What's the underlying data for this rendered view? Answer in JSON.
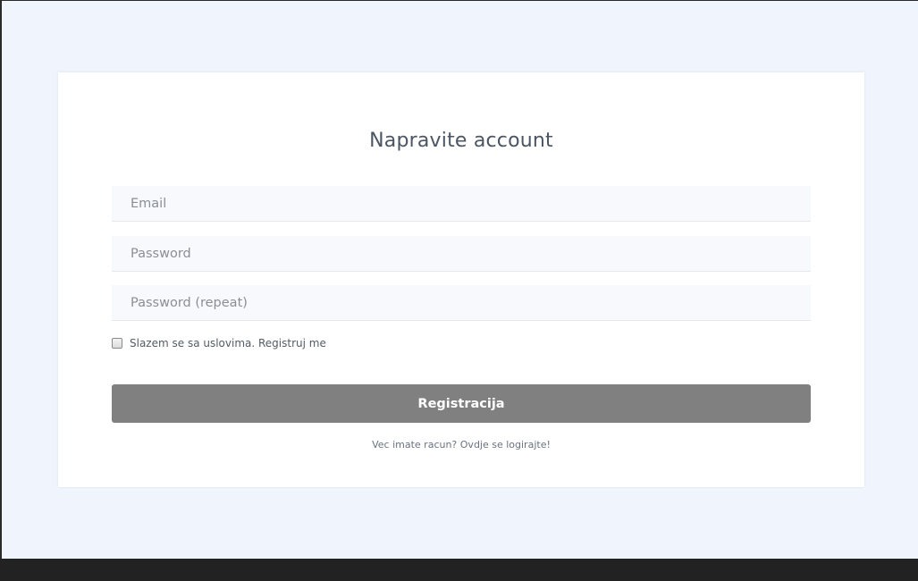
{
  "form": {
    "title": "Napravite account",
    "email_placeholder": "Email",
    "password_placeholder": "Password",
    "password_repeat_placeholder": "Password (repeat)",
    "terms_label": "Slazem se sa uslovima. Registruj me",
    "terms_checked": false,
    "submit_label": "Registracija",
    "login_link": "Vec imate racun? Ovdje se logirajte!"
  },
  "colors": {
    "page_background": "#f0f5fd",
    "card_background": "#ffffff",
    "button_background": "#808080",
    "input_background": "#f7f9fc"
  }
}
